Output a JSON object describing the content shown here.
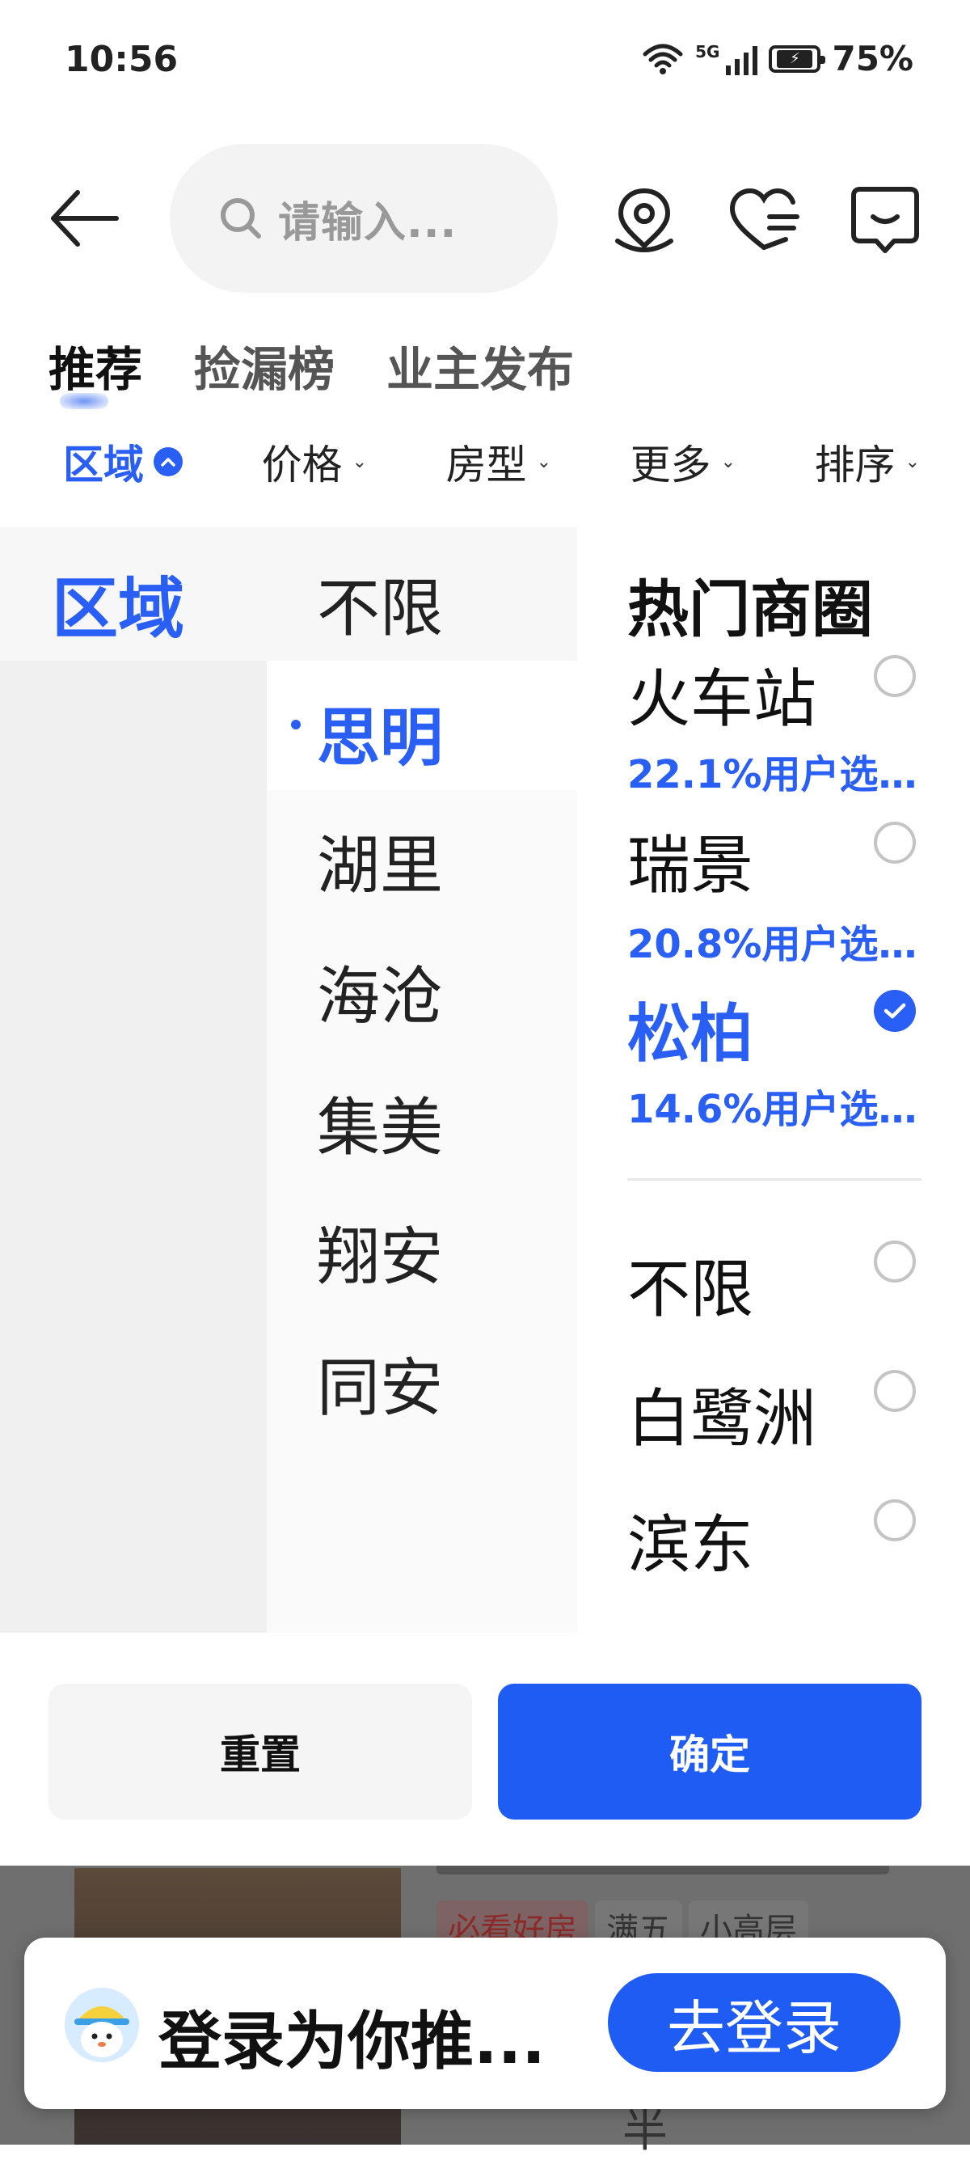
{
  "status_bar": {
    "time": "10:56",
    "network": "5G",
    "battery": "75%"
  },
  "header": {
    "search_placeholder": "请输入...",
    "icons": [
      "back-arrow-icon",
      "location-pin-icon",
      "heart-list-icon",
      "message-icon"
    ]
  },
  "tabs": [
    {
      "label": "推荐",
      "active": true
    },
    {
      "label": "捡漏榜",
      "active": false
    },
    {
      "label": "业主发布",
      "active": false
    }
  ],
  "filters": [
    {
      "label": "区域",
      "active": true
    },
    {
      "label": "价格",
      "active": false
    },
    {
      "label": "房型",
      "active": false
    },
    {
      "label": "更多",
      "active": false
    },
    {
      "label": "排序",
      "active": false
    }
  ],
  "panel": {
    "category": "区域",
    "districts": [
      {
        "label": "不限",
        "selected": false
      },
      {
        "label": "思明",
        "selected": true
      },
      {
        "label": "湖里",
        "selected": false
      },
      {
        "label": "海沧",
        "selected": false
      },
      {
        "label": "集美",
        "selected": false
      },
      {
        "label": "翔安",
        "selected": false
      },
      {
        "label": "同安",
        "selected": false
      }
    ],
    "hot_title": "热门商圈",
    "hot_areas": [
      {
        "name": "火车站",
        "stat": "22.1%用户选...",
        "checked": false
      },
      {
        "name": "瑞景",
        "stat": "20.8%用户选...",
        "checked": false
      },
      {
        "name": "松柏",
        "stat": "14.6%用户选...",
        "checked": true
      }
    ],
    "other_areas": [
      {
        "name": "不限",
        "checked": false
      },
      {
        "name": "白鹭洲",
        "checked": false
      },
      {
        "name": "滨东",
        "checked": false
      }
    ],
    "reset_label": "重置",
    "confirm_label": "确定"
  },
  "background_listing": {
    "tags": [
      "必看好房",
      "满五",
      "小高层"
    ],
    "fragment": "半"
  },
  "login_banner": {
    "text": "登录为你推...",
    "button": "去登录"
  },
  "colors": {
    "accent": "#1f5cf3",
    "selected_text": "#2a5ff5"
  }
}
